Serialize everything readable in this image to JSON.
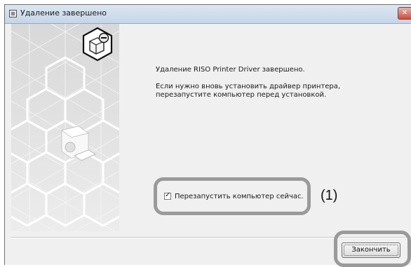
{
  "window": {
    "title": "Удаление завершено",
    "close_symbol": "✕"
  },
  "content": {
    "message_1": "Удаление RISO Printer Driver завершено.",
    "message_2": "Если нужно вновь установить драйвер принтера, перезапустите компьютер перед установкой."
  },
  "restart_option": {
    "label": "Перезапустить компьютер сейчас.",
    "checked": true
  },
  "callout_label": "(1)",
  "buttons": {
    "finish_label": "Закончить"
  },
  "colors": {
    "titlebar": "#c6d6e8",
    "panel": "#e2e2e2",
    "highlight_frame": "#9a9a9a",
    "close_button": "#c7503f"
  },
  "icons": [
    "window-app-icon",
    "close-icon",
    "printer-uninstall-icon",
    "printer-graphic-icon",
    "checkmark-icon"
  ]
}
